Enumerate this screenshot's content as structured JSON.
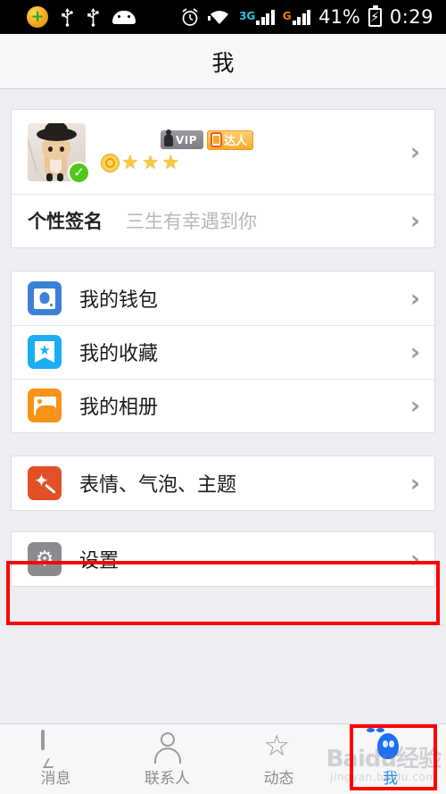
{
  "statusbar": {
    "icons_left": [
      "plus-circle-icon",
      "usb-icon",
      "usb-icon",
      "android-robot-icon"
    ],
    "alarm_icon": "alarm-clock-icon",
    "wifi_icon": "wifi-icon",
    "network_3g_label": "3G",
    "network_g_label": "G",
    "battery_percent": "41%",
    "battery_icon": "battery-charging-icon",
    "time": "0:29"
  },
  "titlebar": {
    "title": "我"
  },
  "profile": {
    "avatar_name": "cat-avatar",
    "verified_icon": "verified-check-icon",
    "sun_level_icon": "sun-level-icon",
    "star_count": 3,
    "star_icon": "star-icon",
    "vip_label": "VIP",
    "daren_label": "达人",
    "chevron": "›"
  },
  "signature": {
    "label": "个性签名",
    "value": "三生有幸遇到你",
    "chevron": "›"
  },
  "menu_group_1": [
    {
      "label": "我的钱包",
      "icon": "wallet-icon",
      "color": "#3b82d6",
      "chevron": "›"
    },
    {
      "label": "我的收藏",
      "icon": "bookmark-star-icon",
      "color": "#1baef5",
      "chevron": "›"
    },
    {
      "label": "我的相册",
      "icon": "photo-album-icon",
      "color": "#f79319",
      "chevron": "›"
    }
  ],
  "menu_group_2": [
    {
      "label": "表情、气泡、主题",
      "icon": "magic-wand-icon",
      "color": "#e2502a",
      "chevron": "›"
    }
  ],
  "menu_group_3": [
    {
      "label": "设置",
      "icon": "gear-icon",
      "color": "#8a8a90",
      "chevron": "›"
    }
  ],
  "tabbar": {
    "items": [
      {
        "label": "消息",
        "icon": "chat-bubble-icon",
        "active": false
      },
      {
        "label": "联系人",
        "icon": "person-icon",
        "active": false
      },
      {
        "label": "动态",
        "icon": "star-outline-icon",
        "active": false
      },
      {
        "label": "我",
        "icon": "penguin-icon",
        "active": true
      }
    ]
  },
  "watermark": {
    "main": "Baidu经验",
    "sub": "jingyan.baidu.com"
  },
  "highlights": {
    "color": "#ff0000",
    "targets": [
      "设置",
      "我"
    ]
  }
}
